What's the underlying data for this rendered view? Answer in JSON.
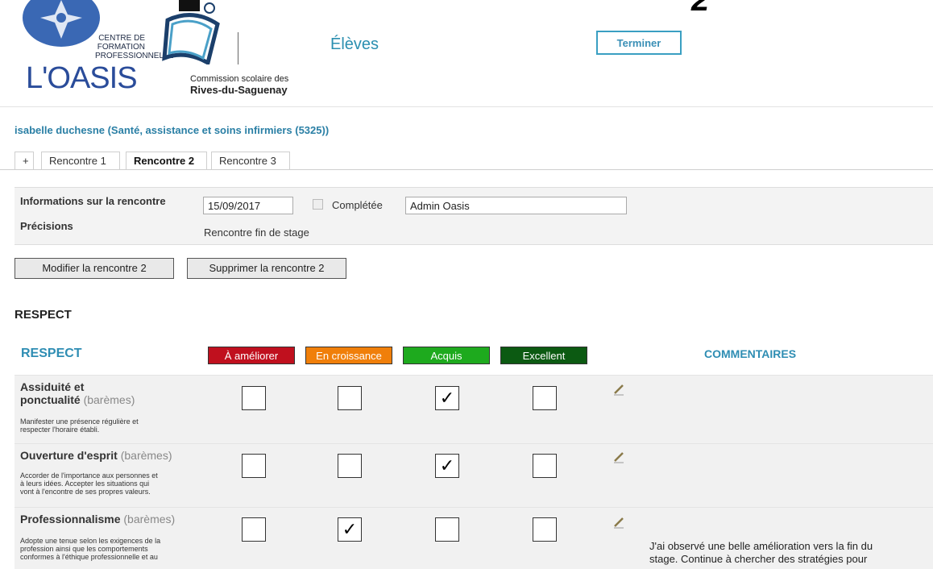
{
  "header": {
    "logo_oasis": {
      "line1": "CENTRE DE",
      "line2": "FORMATION",
      "line3": "PROFESSIONNELLE",
      "name": "L'OASIS"
    },
    "logo_csrs": {
      "line1": "Commission scolaire des",
      "line2": "Rives-du-Saguenay"
    },
    "page_title": "Élèves",
    "finish_button": "Terminer",
    "annotation_number": "2"
  },
  "student_line": "isabelle duchesne (Santé, assistance et soins infirmiers (5325))",
  "tabs": [
    {
      "label": "+"
    },
    {
      "label": "Rencontre 1"
    },
    {
      "label": "Rencontre 2",
      "active": true
    },
    {
      "label": "Rencontre 3"
    }
  ],
  "meeting": {
    "info_label": "Informations sur la rencontre",
    "date": "15/09/2017",
    "completed_label": "Complétée",
    "completed": false,
    "author": "Admin Oasis",
    "details_label": "Précisions",
    "details": "Rencontre fin de stage"
  },
  "actions": {
    "modify": "Modifier la rencontre 2",
    "delete": "Supprimer la rencontre 2"
  },
  "section_heading": "RESPECT",
  "grid": {
    "criterion_heading": "RESPECT",
    "levels": [
      {
        "label": "À améliorer",
        "color": "#c0101e"
      },
      {
        "label": "En croissance",
        "color": "#f07f0a"
      },
      {
        "label": "Acquis",
        "color": "#1eaa1e"
      },
      {
        "label": "Excellent",
        "color": "#0c5a12"
      }
    ],
    "comments_heading": "COMMENTAIRES",
    "check_mark": "✓",
    "rows": [
      {
        "name_line1": "Assiduité et",
        "name_line2": "ponctualité",
        "baremes": "(barèmes)",
        "description": [
          "Manifester une présence régulière et",
          "respecter l'horaire établi."
        ],
        "checked_level": 2,
        "comment": ""
      },
      {
        "name": "Ouverture d'esprit",
        "baremes": "(barèmes)",
        "description": [
          "Accorder de l'importance aux personnes et",
          "à leurs idées. Accepter les situations qui",
          "vont à l'encontre de ses propres valeurs."
        ],
        "checked_level": 2,
        "comment": ""
      },
      {
        "name": "Professionnalisme",
        "baremes": "(barèmes)",
        "description": [
          "Adopte une tenue selon les exigences de la",
          "profession ainsi que les comportements",
          "conformes à l'éthique professionnelle et au"
        ],
        "checked_level": 1,
        "comment": "J'ai observé une belle amélioration vers la fin du stage. Continue à chercher des stratégies pour"
      }
    ]
  }
}
